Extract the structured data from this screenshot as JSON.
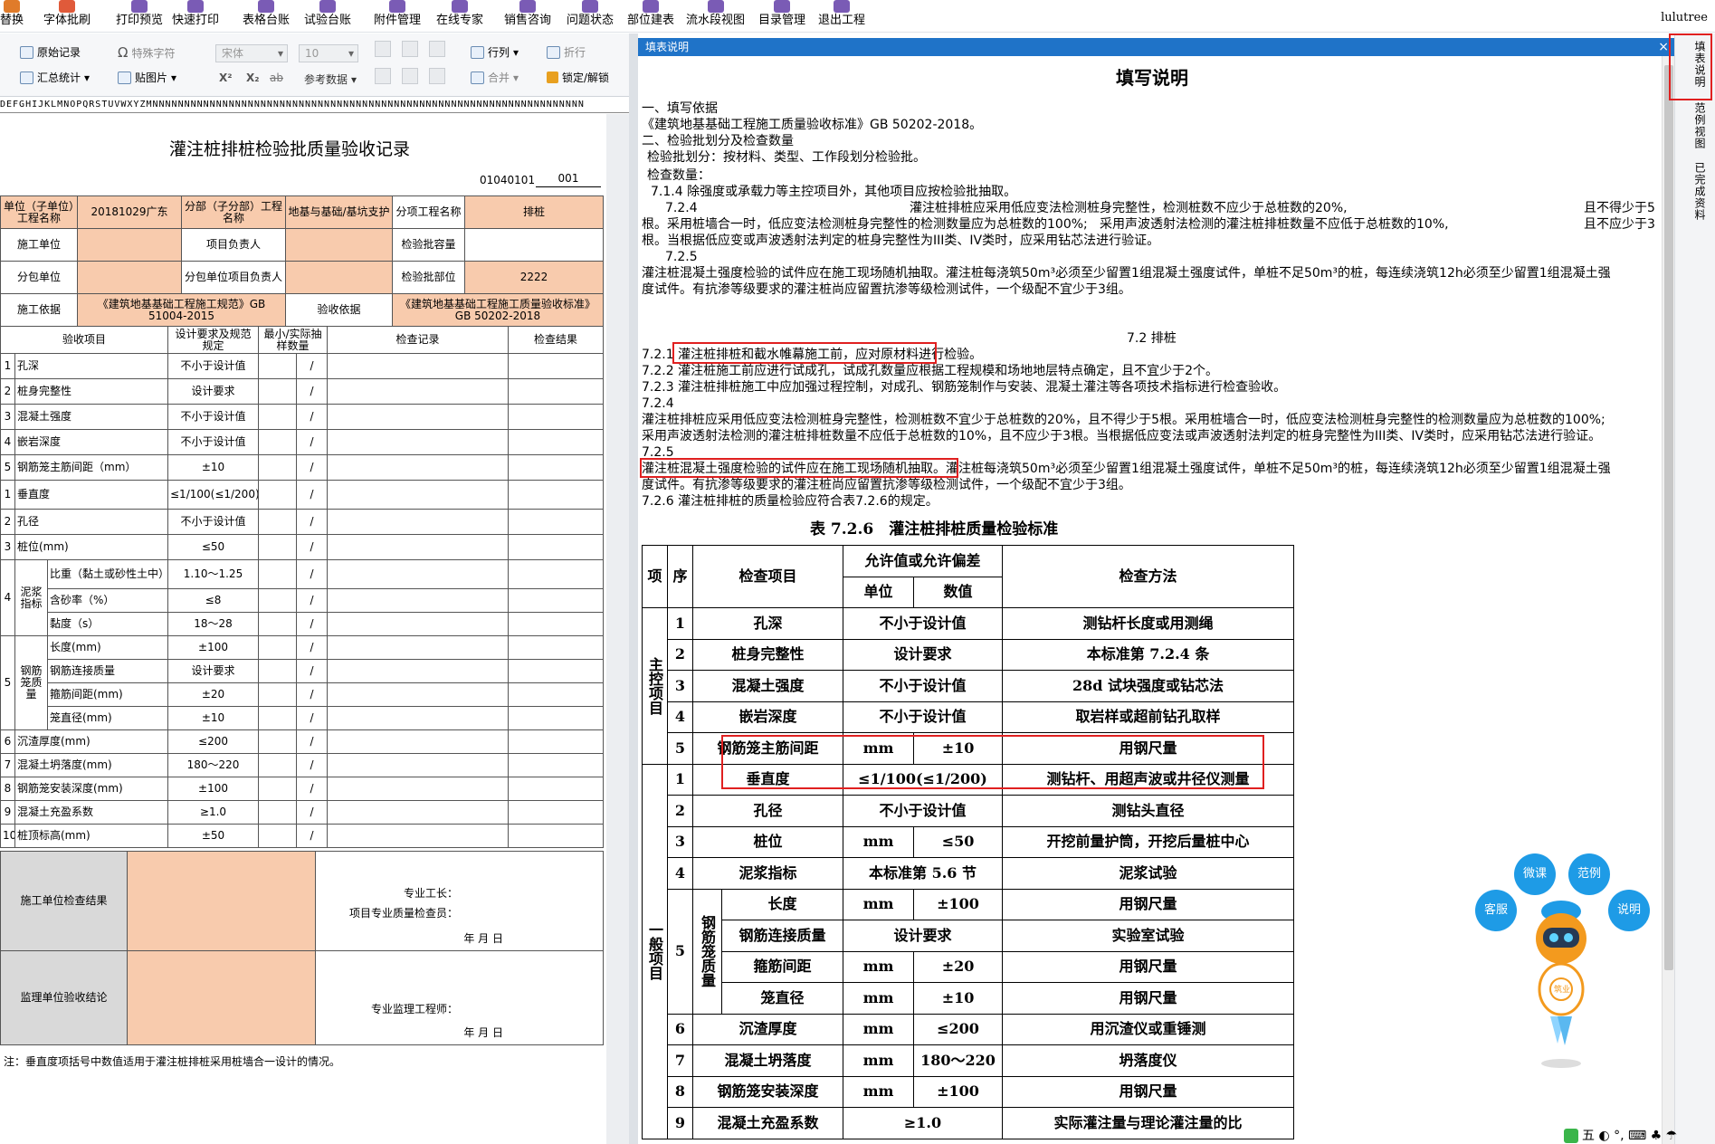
{
  "toolbar": {
    "items": [
      {
        "label": "替换",
        "color": "#e07b2a"
      },
      {
        "label": "字体批刷",
        "color": "#e05a3a"
      },
      {
        "label": "打印预览",
        "color": "#7a5bb5"
      },
      {
        "label": "快速打印",
        "color": "#7a5bb5"
      },
      {
        "label": "表格台账",
        "color": "#7a5bb5"
      },
      {
        "label": "试验台账",
        "color": "#7a5bb5"
      },
      {
        "label": "附件管理",
        "color": "#7a5bb5"
      },
      {
        "label": "在线专家",
        "color": "#7a5bb5"
      },
      {
        "label": "销售咨询",
        "color": "#7a5bb5"
      },
      {
        "label": "问题状态",
        "color": "#7a5bb5"
      },
      {
        "label": "部位建表",
        "color": "#7a5bb5"
      },
      {
        "label": "流水段视图",
        "color": "#7a5bb5"
      },
      {
        "label": "目录管理",
        "color": "#7a5bb5"
      },
      {
        "label": "退出工程",
        "color": "#7a5bb5"
      }
    ],
    "user": "lulutree"
  },
  "ribbon": {
    "original_record": "原始记录",
    "special_char": "特殊字符",
    "summary_stats": "汇总统计",
    "paste_image": "贴图片",
    "font_name": "宋体",
    "font_size": "10",
    "superscript": "X²",
    "subscript": "X₂",
    "strike": "ab",
    "ref_data": "参考数据",
    "row_col": "行列",
    "merge": "合并",
    "fold": "折行",
    "lock": "锁定/解锁"
  },
  "colhdr": "DEFGHIJKLMNOPQRSTUVWXYZMNNNNNNNNNNNNNNNNNNNNNNNNNNNNNNNNNNNNNNNNNNNNNNNNNNNNNNNNNNNNNNNNNNNN",
  "form": {
    "title": "灌注桩排桩检验批质量验收记录",
    "code1": "01040101",
    "code2": "001",
    "h_unit_label": "单位（子单位）工程名称",
    "h_unit_value": "20181029广东",
    "h_sub_label": "分部（子分部）工程名称",
    "h_sub_value": "地基与基础/基坑支护",
    "h_item_label": "分项工程名称",
    "h_item_value": "排桩",
    "h_constr_label": "施工单位",
    "h_pm_label": "项目负责人",
    "h_cap_label": "检验批容量",
    "h_subc_label": "分包单位",
    "h_subpm_label": "分包单位项目负责人",
    "h_part_label": "检验批部位",
    "h_part_value": "2222",
    "h_basis_label": "施工依据",
    "h_basis_value": "《建筑地基基础工程施工规范》GB 51004-2015",
    "h_accept_label": "验收依据",
    "h_accept_value": "《建筑地基基础工程施工质量验收标准》GB 50202-2018",
    "c_item": "验收项目",
    "c_req": "设计要求及规范规定",
    "c_min": "最小/实际抽样数量",
    "c_rec": "检查记录",
    "c_res": "检查结果",
    "rows": [
      {
        "n": "1",
        "name": "孔深",
        "req": "不小于设计值",
        "min": "/"
      },
      {
        "n": "2",
        "name": "桩身完整性",
        "req": "设计要求",
        "min": "/"
      },
      {
        "n": "3",
        "name": "混凝土强度",
        "req": "不小于设计值",
        "min": "/"
      },
      {
        "n": "4",
        "name": "嵌岩深度",
        "req": "不小于设计值",
        "min": "/"
      },
      {
        "n": "5",
        "name": "钢筋笼主筋间距（mm）",
        "req": "±10",
        "min": "/"
      },
      {
        "n": "1",
        "name": "垂直度",
        "req": "≤1/100(≤1/200)",
        "min": "/"
      },
      {
        "n": "2",
        "name": "孔径",
        "req": "不小于设计值",
        "min": "/"
      },
      {
        "n": "3",
        "name": "桩位(mm)",
        "req": "≤50",
        "min": "/"
      }
    ],
    "g4_n": "4",
    "g4_label": "泥浆指标",
    "g4_rows": [
      {
        "name": "比重（黏土或砂性土中）",
        "req": "1.10～1.25",
        "min": "/"
      },
      {
        "name": "含砂率（%）",
        "req": "≤8",
        "min": "/"
      },
      {
        "name": "黏度（s）",
        "req": "18～28",
        "min": "/"
      }
    ],
    "g5_n": "5",
    "g5_label": "钢筋笼质量",
    "g5_rows": [
      {
        "name": "长度(mm)",
        "req": "±100",
        "min": "/"
      },
      {
        "name": "钢筋连接质量",
        "req": "设计要求",
        "min": "/"
      },
      {
        "name": "箍筋间距(mm)",
        "req": "±20",
        "min": "/"
      },
      {
        "name": "笼直径(mm)",
        "req": "±10",
        "min": "/"
      }
    ],
    "tail_rows": [
      {
        "n": "6",
        "name": "沉渣厚度(mm)",
        "req": "≤200",
        "min": "/"
      },
      {
        "n": "7",
        "name": "混凝土坍落度(mm)",
        "req": "180～220",
        "min": "/"
      },
      {
        "n": "8",
        "name": "钢筋笼安装深度(mm)",
        "req": "±100",
        "min": "/"
      },
      {
        "n": "9",
        "name": "混凝土充盈系数",
        "req": "≥1.0",
        "min": "/"
      },
      {
        "n": "10",
        "name": "桩顶标高(mm)",
        "req": "±50",
        "min": "/"
      }
    ],
    "s_constr_result": "施工单位检查结果",
    "s_foreman": "专业工长：",
    "s_inspector": "项目专业质量检查员：",
    "s_date": "年    月    日",
    "s_super_result": "监理单位验收结论",
    "s_super_eng": "专业监理工程师：",
    "footnote": "注：垂直度项括号中数值适用于灌注桩排桩采用桩墙合一设计的情况。"
  },
  "help": {
    "bar_title": "填表说明",
    "close": "×",
    "title": "填写说明",
    "l1": "一、填写依据",
    "l2": "《建筑地基基础工程施工质量验收标准》GB 50202-2018。",
    "l3": "二、检验批划分及检查数量",
    "l4": "检验批划分：按材料、类型、工作段划分检验批。",
    "l5": "检查数量：",
    "l6": "7.1.4 除强度或承载力等主控项目外，其他项目应按检验批抽取。",
    "l7a": "7.2.4",
    "l7b": "灌注桩排桩应采用低应变法检测桩身完整性，检测桩数不应少于总桩数的20%,",
    "l7c": "且不得少于5",
    "l8a": "根。采用桩墙合一时，低应变法检测桩身完整性的检测数量应为总桩数的100%;",
    "l8b": "采用声波透射法检测的灌注桩排桩数量不应低于总桩数的10%,",
    "l8c": "且不应少于3",
    "l9": "根。当根据低应变或声波透射法判定的桩身完整性为III类、IV类时，应采用钻芯法进行验证。",
    "l10": "7.2.5",
    "l11": "灌注桩混凝土强度检验的试件应在施工现场随机抽取。灌注桩每浇筑50m³必须至少留置1组混凝土强度试件，单桩不足50m³的桩，每连续浇筑12h必须至少留置1组混凝土强",
    "l12": "度试件。有抗渗等级要求的灌注桩尚应留置抗渗等级检测试件，一个级配不宜少于3组。",
    "s72": "7.2 排桩",
    "p721": "7.2.1 灌注桩排桩和截水帷幕施工前，应对原材料进行检验。",
    "p722": "7.2.2 灌注桩施工前应进行试成孔，试成孔数量应根据工程规模和场地地层特点确定，且不宜少于2个。",
    "p723": "7.2.3 灌注桩排桩施工中应加强过程控制，对成孔、钢筋笼制作与安装、混凝土灌注等各项技术指标进行检查验收。",
    "p724": "7.2.4",
    "p724a": "灌注桩排桩应采用低应变法检测桩身完整性，检测桩数不宜少于总桩数的20%，且不得少于5根。采用桩墙合一时，低应变法检测桩身完整性的检测数量应为总桩数的100%;",
    "p724b": "采用声波透射法检测的灌注桩排桩数量不应低于总桩数的10%，且不应少于3根。当根据低应变法或声波透射法判定的桩身完整性为III类、IV类时，应采用钻芯法进行验证。",
    "p725": "7.2.5",
    "p725a": "灌注桩混凝土强度检验的试件应在施工现场随机抽取。灌注桩每浇筑50m³必须至少留置1组混凝土强度试件，单桩不足50m³的桩，每连续浇筑12h必须至少留置1组混凝土强",
    "p725b": "度试件。有抗渗等级要求的灌注桩尚应留置抗渗等级检测试件，一个级配不宜少于3组。",
    "p726": "7.2.6 灌注桩排桩的质量检验应符合表7.2.6的规定。",
    "table_title": "表 7.2.6　灌注桩排桩质量检验标准",
    "t": {
      "h_xiang": "项",
      "h_xu": "序",
      "h_item": "检查项目",
      "h_allow": "允许值或允许偏差",
      "h_unit": "单位",
      "h_val": "数值",
      "h_method": "检查方法",
      "g_main": "主控项目",
      "g_gen": "一般项目",
      "main": [
        {
          "n": "1",
          "item": "孔深",
          "span": "不小于设计值",
          "method": "测钻杆长度或用测绳"
        },
        {
          "n": "2",
          "item": "桩身完整性",
          "span": "设计要求",
          "method": "本标准第 7.2.4 条"
        },
        {
          "n": "3",
          "item": "混凝土强度",
          "span": "不小于设计值",
          "method": "28d 试块强度或钻芯法"
        },
        {
          "n": "4",
          "item": "嵌岩深度",
          "span": "不小于设计值",
          "method": "取岩样或超前钻孔取样"
        }
      ],
      "m5": {
        "n": "5",
        "item": "钢筋笼主筋间距",
        "unit": "mm",
        "val": "±10",
        "method": "用钢尺量"
      },
      "g1": {
        "n": "1",
        "item": "垂直度",
        "span": "≤1/100(≤1/200)",
        "method": "测钻杆、用超声波或井径仪测量"
      },
      "g2": {
        "n": "2",
        "item": "孔径",
        "span": "不小于设计值",
        "method": "测钻头直径"
      },
      "g3": {
        "n": "3",
        "item": "桩位",
        "unit": "mm",
        "val": "≤50",
        "method": "开挖前量护筒，开挖后量桩中心"
      },
      "g4": {
        "n": "4",
        "item": "泥浆指标",
        "span": "本标准第 5.6 节",
        "method": "泥浆试验"
      },
      "g5n": "5",
      "g5label": "钢筋笼质量",
      "g5": [
        {
          "item": "长度",
          "unit": "mm",
          "val": "±100",
          "method": "用钢尺量"
        },
        {
          "item": "钢筋连接质量",
          "span": "设计要求",
          "method": "实验室试验"
        },
        {
          "item": "箍筋间距",
          "unit": "mm",
          "val": "±20",
          "method": "用钢尺量"
        },
        {
          "item": "笼直径",
          "unit": "mm",
          "val": "±10",
          "method": "用钢尺量"
        }
      ],
      "g6": {
        "n": "6",
        "item": "沉渣厚度",
        "unit": "mm",
        "val": "≤200",
        "method": "用沉渣仪或重锤测"
      },
      "g7": {
        "n": "7",
        "item": "混凝土坍落度",
        "unit": "mm",
        "val": "180～220",
        "method": "坍落度仪"
      },
      "g8": {
        "n": "8",
        "item": "钢筋笼安装深度",
        "unit": "mm",
        "val": "±100",
        "method": "用钢尺量"
      },
      "g9": {
        "n": "9",
        "item": "混凝土充盈系数",
        "span": "≥1.0",
        "method": "实际灌注量与理论灌注量的比"
      }
    }
  },
  "side_tabs": [
    "填表说明",
    "范例视图",
    "已完成资料"
  ],
  "assistant": {
    "bubbles": [
      "微课",
      "范例",
      "客服",
      "说明"
    ],
    "badge": "筑业"
  },
  "tray": "五 ◐ °, ⌨ ♣ ☂"
}
